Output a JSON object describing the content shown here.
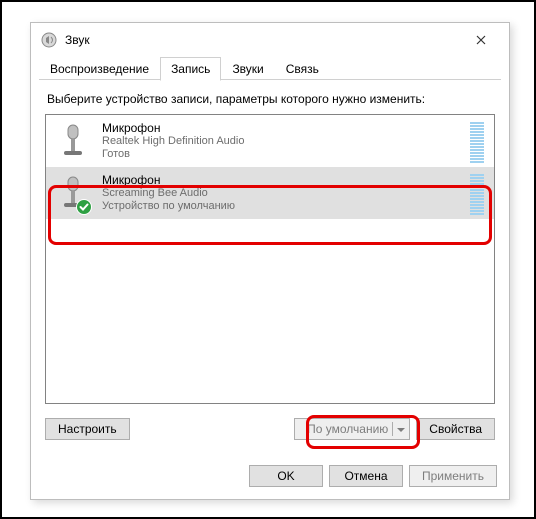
{
  "window": {
    "title": "Звук"
  },
  "tabs": [
    {
      "label": "Воспроизведение"
    },
    {
      "label": "Запись"
    },
    {
      "label": "Звуки"
    },
    {
      "label": "Связь"
    }
  ],
  "active_tab": 1,
  "instruction": "Выберите устройство записи, параметры которого нужно изменить:",
  "devices": [
    {
      "name": "Микрофон",
      "driver": "Realtek High Definition Audio",
      "status": "Готов",
      "default": false,
      "selected": false
    },
    {
      "name": "Микрофон",
      "driver": "Screaming Bee Audio",
      "status": "Устройство по умолчанию",
      "default": true,
      "selected": true
    }
  ],
  "buttons": {
    "configure": "Настроить",
    "set_default": "По умолчанию",
    "properties": "Свойства",
    "ok": "OK",
    "cancel": "Отмена",
    "apply": "Применить"
  }
}
